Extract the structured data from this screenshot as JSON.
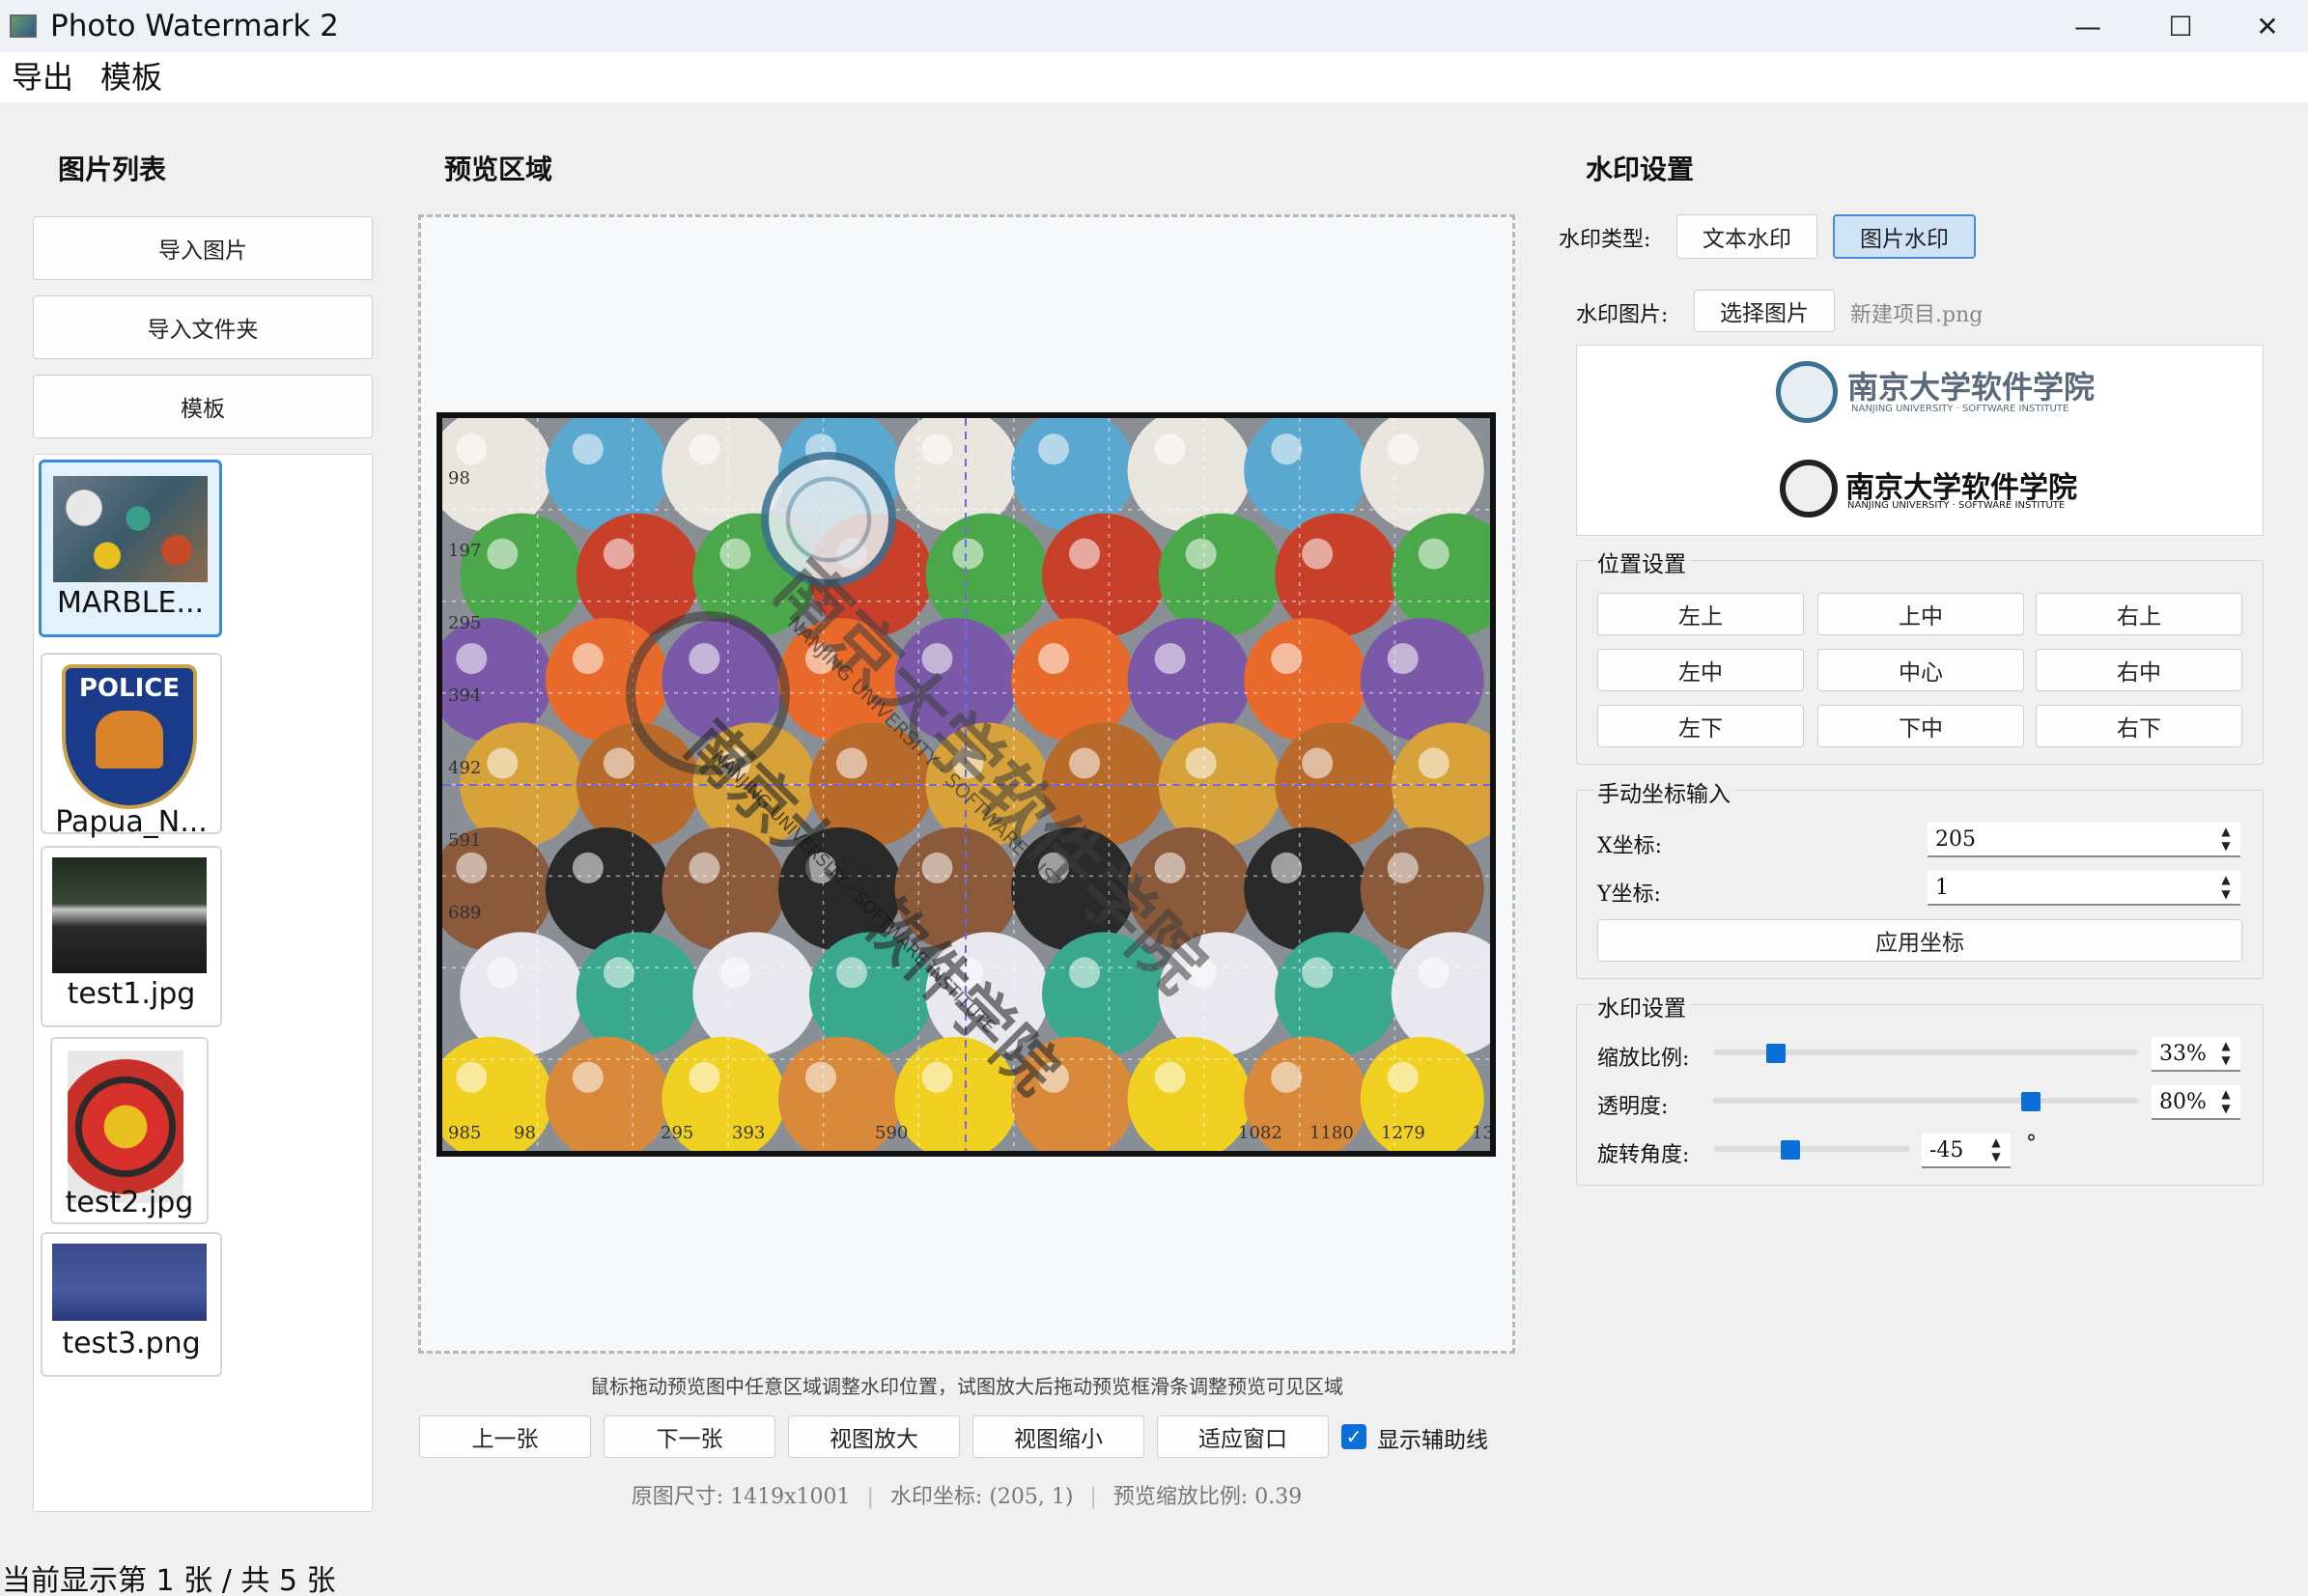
{
  "window": {
    "title": "Photo Watermark 2",
    "minimize": "—",
    "maximize": "☐",
    "close": "✕"
  },
  "menu": {
    "export": "导出",
    "template": "模板"
  },
  "left": {
    "heading": "图片列表",
    "import_image": "导入图片",
    "import_folder": "导入文件夹",
    "template": "模板",
    "files": [
      {
        "name": "MARBLE...",
        "selected": true
      },
      {
        "name": "Papua_N...",
        "selected": false
      },
      {
        "name": "test1.jpg",
        "selected": false
      },
      {
        "name": "test2.jpg",
        "selected": false
      },
      {
        "name": "test3.png",
        "selected": false
      }
    ],
    "police_text": "POLICE"
  },
  "preview": {
    "heading": "预览区域",
    "grid_labels_y": [
      "98",
      "197",
      "295",
      "394",
      "492",
      "591",
      "689"
    ],
    "grid_labels_x": [
      "985",
      "98",
      "295",
      "393",
      "590",
      "1082",
      "1180",
      "1279",
      "13"
    ],
    "watermark_text": "南京大学软件学院",
    "watermark_sub": "NANJING UNIVERSITY · SOFTWARE INSTITUTE",
    "hint": "鼠标拖动预览图中任意区域调整水印位置，试图放大后拖动预览框滑条调整预览可见区域",
    "prev": "上一张",
    "next": "下一张",
    "zoom_in": "视图放大",
    "zoom_out": "视图缩小",
    "fit": "适应窗口",
    "show_guides": "显示辅助线",
    "show_guides_checked": true,
    "info_size": "原图尺寸: 1419x1001",
    "info_coord": "水印坐标: (205, 1)",
    "info_scale": "预览缩放比例: 0.39"
  },
  "settings": {
    "heading": "水印设置",
    "type_label": "水印类型:",
    "type_text": "文本水印",
    "type_image": "图片水印",
    "image_label": "水印图片:",
    "choose_image": "选择图片",
    "image_file": "新建项目.png",
    "logo_text": "南京大学软件学院",
    "logo_sub": "NANJING UNIVERSITY · SOFTWARE INSTITUTE",
    "position": {
      "title": "位置设置",
      "buttons": [
        "左上",
        "上中",
        "右上",
        "左中",
        "中心",
        "右中",
        "左下",
        "下中",
        "右下"
      ]
    },
    "manual": {
      "title": "手动坐标输入",
      "x_label": "X坐标:",
      "x_value": "205",
      "y_label": "Y坐标:",
      "y_value": "1",
      "apply": "应用坐标"
    },
    "wm": {
      "title": "水印设置",
      "scale_label": "缩放比例:",
      "scale_value": "33%",
      "scale_level": 0.13,
      "opacity_label": "透明度:",
      "opacity_value": "80%",
      "opacity_level": 0.76,
      "rotate_label": "旋转角度:",
      "rotate_value": "-45",
      "rotate_level": 0.38,
      "degree": "°"
    }
  },
  "status": "当前显示第 1 张 / 共 5 张",
  "colors": {
    "accent": "#0a6fd8",
    "selected_border": "#3a8ad6",
    "active_button_bg": "#cfe3f7"
  }
}
